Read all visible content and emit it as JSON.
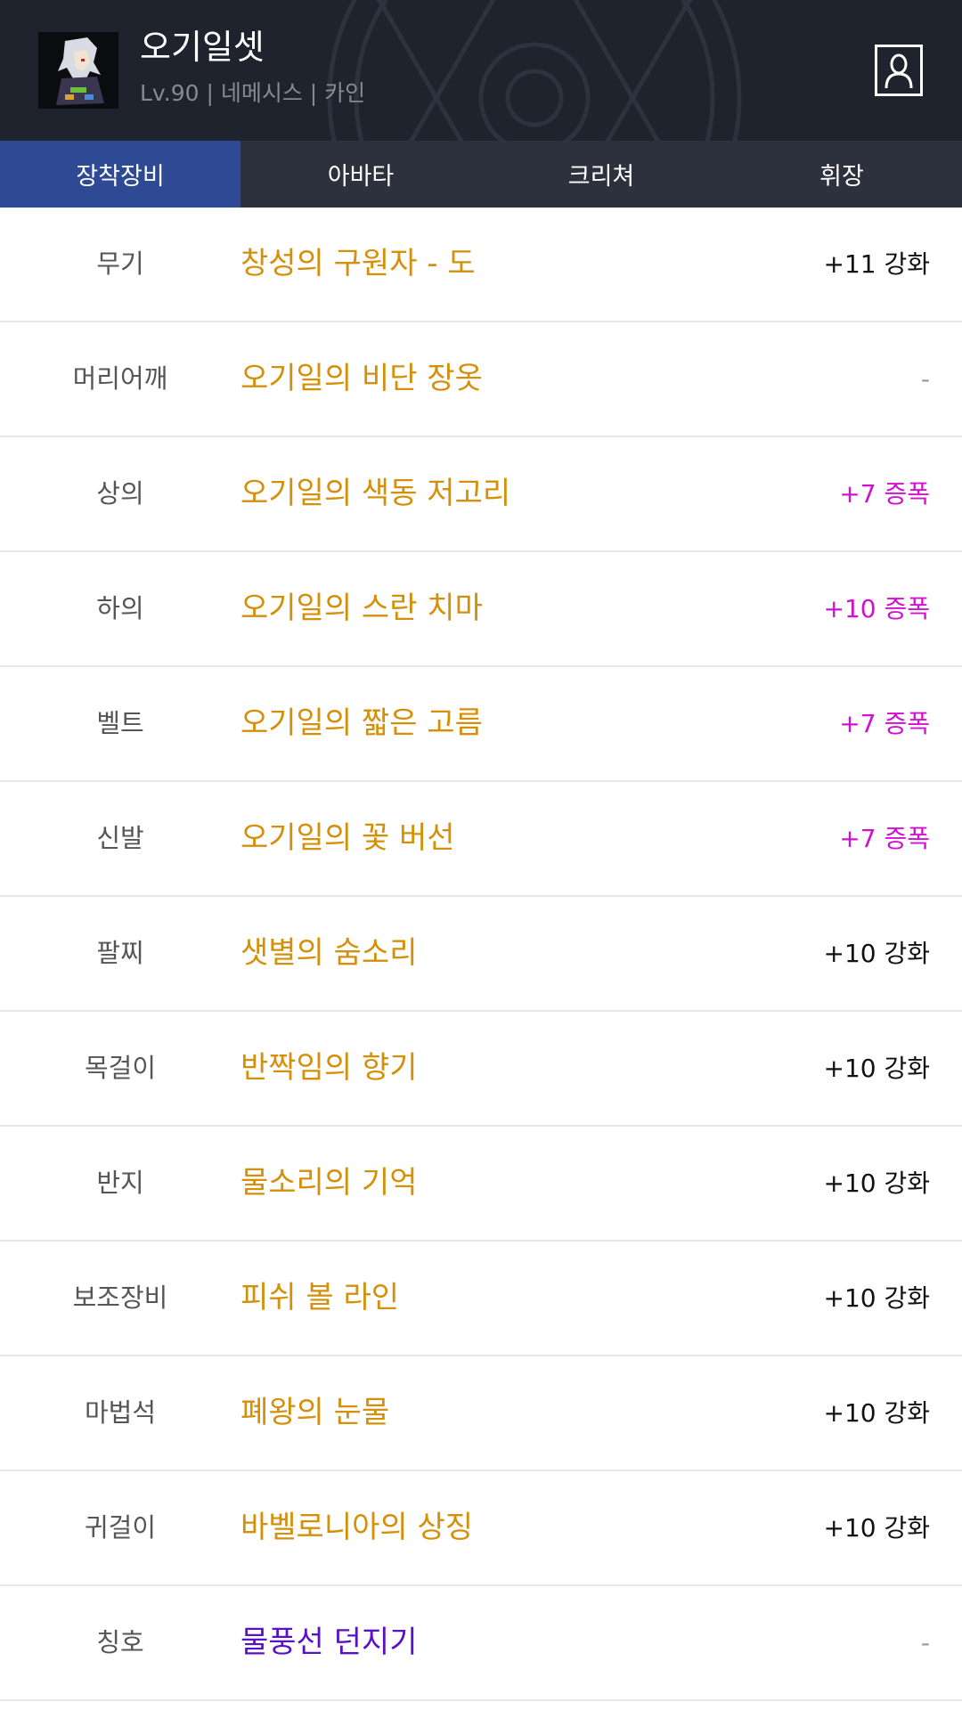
{
  "header": {
    "character_name": "오기일셋",
    "character_info": "Lv.90 | 네메시스 | 카인",
    "avatar_icon": "character-portrait-icon",
    "profile_icon": "person-icon"
  },
  "tabs": [
    {
      "label": "장착장비",
      "active": true
    },
    {
      "label": "아바타",
      "active": false
    },
    {
      "label": "크리쳐",
      "active": false
    },
    {
      "label": "휘장",
      "active": false
    }
  ],
  "colors": {
    "header_bg": "#1f232d",
    "tab_bar_bg": "#2d313e",
    "tab_active_bg": "#2e4a94",
    "item_gold": "#d4900a",
    "item_purple": "#5a0fc8",
    "amplify_magenta": "#d210d2",
    "reinforce_black": "#111111",
    "none_gray": "#999999"
  },
  "equipment": [
    {
      "slot": "무기",
      "name": "창성의 구원자 - 도",
      "name_color": "#d4900a",
      "upgrade": "+11 강화",
      "upgrade_color": "#111111"
    },
    {
      "slot": "머리어깨",
      "name": "오기일의 비단 장옷",
      "name_color": "#d4900a",
      "upgrade": "-",
      "upgrade_color": "#999999"
    },
    {
      "slot": "상의",
      "name": "오기일의 색동 저고리",
      "name_color": "#d4900a",
      "upgrade": "+7 증폭",
      "upgrade_color": "#d210d2"
    },
    {
      "slot": "하의",
      "name": "오기일의 스란 치마",
      "name_color": "#d4900a",
      "upgrade": "+10 증폭",
      "upgrade_color": "#d210d2"
    },
    {
      "slot": "벨트",
      "name": "오기일의 짧은 고름",
      "name_color": "#d4900a",
      "upgrade": "+7 증폭",
      "upgrade_color": "#d210d2"
    },
    {
      "slot": "신발",
      "name": "오기일의 꽃 버선",
      "name_color": "#d4900a",
      "upgrade": "+7 증폭",
      "upgrade_color": "#d210d2"
    },
    {
      "slot": "팔찌",
      "name": "샛별의 숨소리",
      "name_color": "#d4900a",
      "upgrade": "+10 강화",
      "upgrade_color": "#111111"
    },
    {
      "slot": "목걸이",
      "name": "반짝임의 향기",
      "name_color": "#d4900a",
      "upgrade": "+10 강화",
      "upgrade_color": "#111111"
    },
    {
      "slot": "반지",
      "name": "물소리의 기억",
      "name_color": "#d4900a",
      "upgrade": "+10 강화",
      "upgrade_color": "#111111"
    },
    {
      "slot": "보조장비",
      "name": "피쉬 볼 라인",
      "name_color": "#d4900a",
      "upgrade": "+10 강화",
      "upgrade_color": "#111111"
    },
    {
      "slot": "마법석",
      "name": "폐왕의 눈물",
      "name_color": "#d4900a",
      "upgrade": "+10 강화",
      "upgrade_color": "#111111"
    },
    {
      "slot": "귀걸이",
      "name": "바벨로니아의 상징",
      "name_color": "#d4900a",
      "upgrade": "+10 강화",
      "upgrade_color": "#111111"
    },
    {
      "slot": "칭호",
      "name": "물풍선 던지기",
      "name_color": "#5a0fc8",
      "upgrade": "-",
      "upgrade_color": "#999999"
    }
  ]
}
